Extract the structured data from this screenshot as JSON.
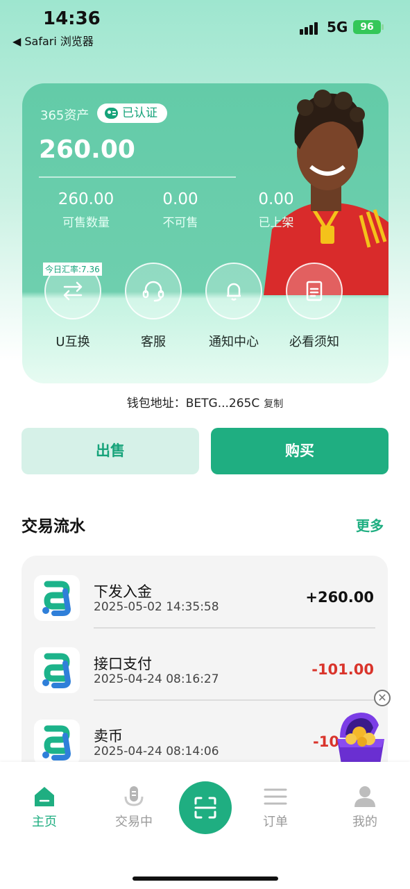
{
  "status": {
    "time": "14:36",
    "back_app": "◀ Safari 浏览器",
    "network": "5G",
    "battery": "96"
  },
  "asset": {
    "label": "365资产",
    "verified": "已认证",
    "total": "260.00",
    "stats": [
      {
        "value": "260.00",
        "label": "可售数量"
      },
      {
        "value": "0.00",
        "label": "不可售"
      },
      {
        "value": "0.00",
        "label": "已上架"
      }
    ],
    "rate_tag": "今日汇率:7.36",
    "quick_actions": [
      {
        "label": "U互换",
        "icon": "exchange-icon"
      },
      {
        "label": "客服",
        "icon": "headset-icon"
      },
      {
        "label": "通知中心",
        "icon": "bell-icon"
      },
      {
        "label": "必看须知",
        "icon": "notice-book-icon"
      }
    ]
  },
  "wallet": {
    "text": "钱包地址：BETG...265C",
    "copy": "复制"
  },
  "actions": {
    "sell": "出售",
    "buy": "购买"
  },
  "transactions": {
    "title": "交易流水",
    "more": "更多",
    "items": [
      {
        "title": "下发入金",
        "date": "2025-05-02 14:35:58",
        "amount": "+260.00",
        "color": "#111111"
      },
      {
        "title": "接口支付",
        "date": "2025-04-24 08:16:27",
        "amount": "-101.00",
        "color": "#d9342b"
      },
      {
        "title": "卖币",
        "date": "2025-04-24 08:14:06",
        "amount": "-10",
        "color": "#d9342b"
      }
    ]
  },
  "tabbar": {
    "home": "主页",
    "trading": "交易中",
    "orders": "订单",
    "mine": "我的"
  },
  "colors": {
    "accent": "#1fae81",
    "negative": "#d9342b"
  }
}
